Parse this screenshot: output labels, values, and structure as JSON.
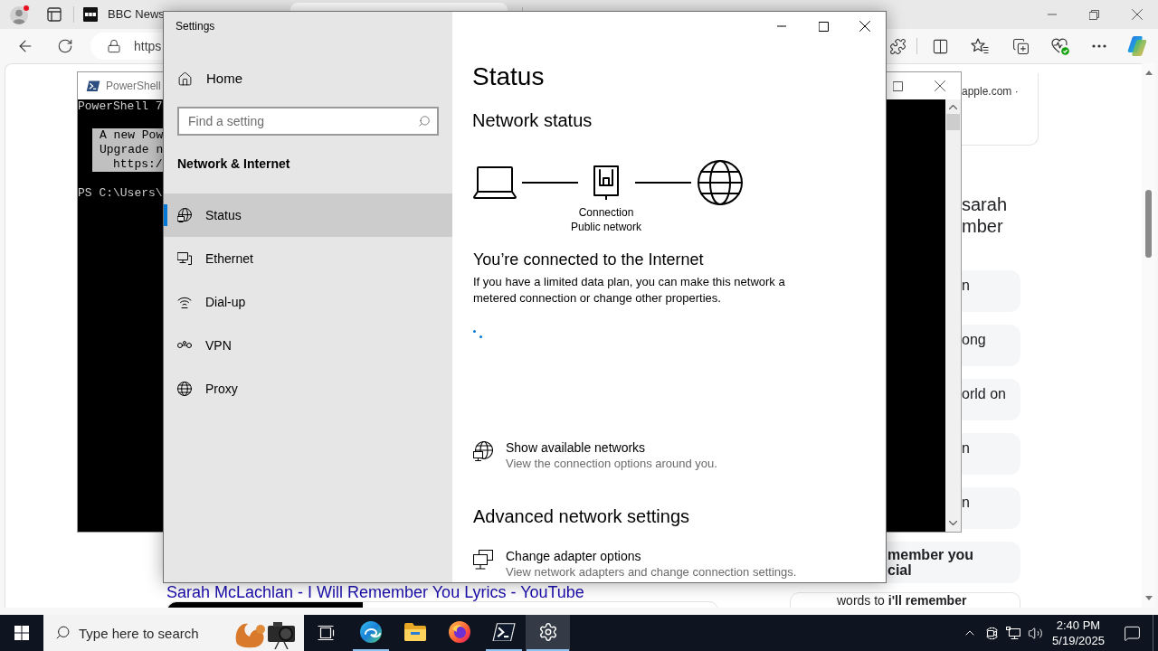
{
  "browser": {
    "tabs": [
      {
        "label": "BBC News",
        "selected": false
      },
      {
        "selected": true
      }
    ],
    "address": {
      "value": "https"
    },
    "page": {
      "source": "apple.com ·",
      "heading": [
        "sarah",
        "mber"
      ],
      "cards": [
        "n",
        "ong",
        "orld on",
        "n",
        "n"
      ],
      "highlight_card": [
        "member you",
        "cial"
      ],
      "result_link": "Sarah McLachlan - I Will Remember You Lyrics - YouTube",
      "snippet": "words to **i'll remember**"
    }
  },
  "powershell": {
    "title": "PowerShell",
    "banner": "PowerShell 7",
    "notice": [
      "A new Pow",
      "Upgrade n",
      "https:/"
    ],
    "prompt": "PS C:\\Users\\"
  },
  "settings": {
    "title": "Settings",
    "home": "Home",
    "search": {
      "placeholder": "Find a setting"
    },
    "section": "Network & Internet",
    "nav": [
      {
        "label": "Status",
        "selected": true
      },
      {
        "label": "Ethernet",
        "selected": false
      },
      {
        "label": "Dial-up",
        "selected": false
      },
      {
        "label": "VPN",
        "selected": false
      },
      {
        "label": "Proxy",
        "selected": false
      }
    ],
    "page_title": "Status",
    "network_status": {
      "heading": "Network status",
      "connection": "Connection",
      "network_type": "Public network",
      "message": "You’re connected to the Internet",
      "description": "If you have a limited data plan, you can make this network a metered connection or change other properties."
    },
    "links": [
      {
        "title": "Show available networks",
        "subtitle": "View the connection options around you."
      }
    ],
    "advanced": {
      "heading": "Advanced network settings",
      "links": [
        {
          "title": "Change adapter options",
          "subtitle": "View network adapters and change connection settings."
        }
      ]
    }
  },
  "taskbar": {
    "search": {
      "placeholder": "Type here to search"
    },
    "apps": [
      {
        "running": true,
        "selected": false
      },
      {
        "running": false,
        "selected": false
      },
      {
        "running": false,
        "selected": false
      },
      {
        "running": true,
        "selected": false
      },
      {
        "running": true,
        "selected": true
      }
    ],
    "clock": {
      "time": "2:40 PM",
      "date": "5/19/2025"
    }
  }
}
